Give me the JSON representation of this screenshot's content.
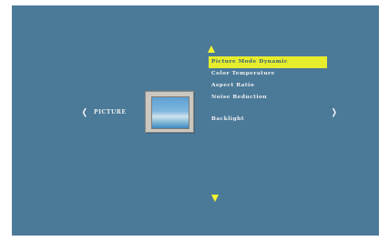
{
  "screen": {
    "background_color": "#4b7a99",
    "highlight_color": "#e6ed2c",
    "arrow_color": "#f3f32e"
  },
  "nav": {
    "left_icon": "chevron-left-icon",
    "right_icon": "chevron-right-icon",
    "left_glyph": "❬",
    "right_glyph": "❭",
    "section_label": "PICTURE"
  },
  "thumbnail": {
    "icon": "picture-icon"
  },
  "menu": {
    "up_icon": "triangle-up-icon",
    "down_icon": "triangle-down-icon",
    "items": [
      {
        "label": "Picture Mode Dynamic",
        "selected": true
      },
      {
        "label": "Color Temperature",
        "selected": false
      },
      {
        "label": "Aspect Ratio",
        "selected": false
      },
      {
        "label": "Noise Reduction",
        "selected": false
      },
      {
        "label": "",
        "selected": false
      },
      {
        "label": "Backlight",
        "selected": false
      }
    ]
  }
}
